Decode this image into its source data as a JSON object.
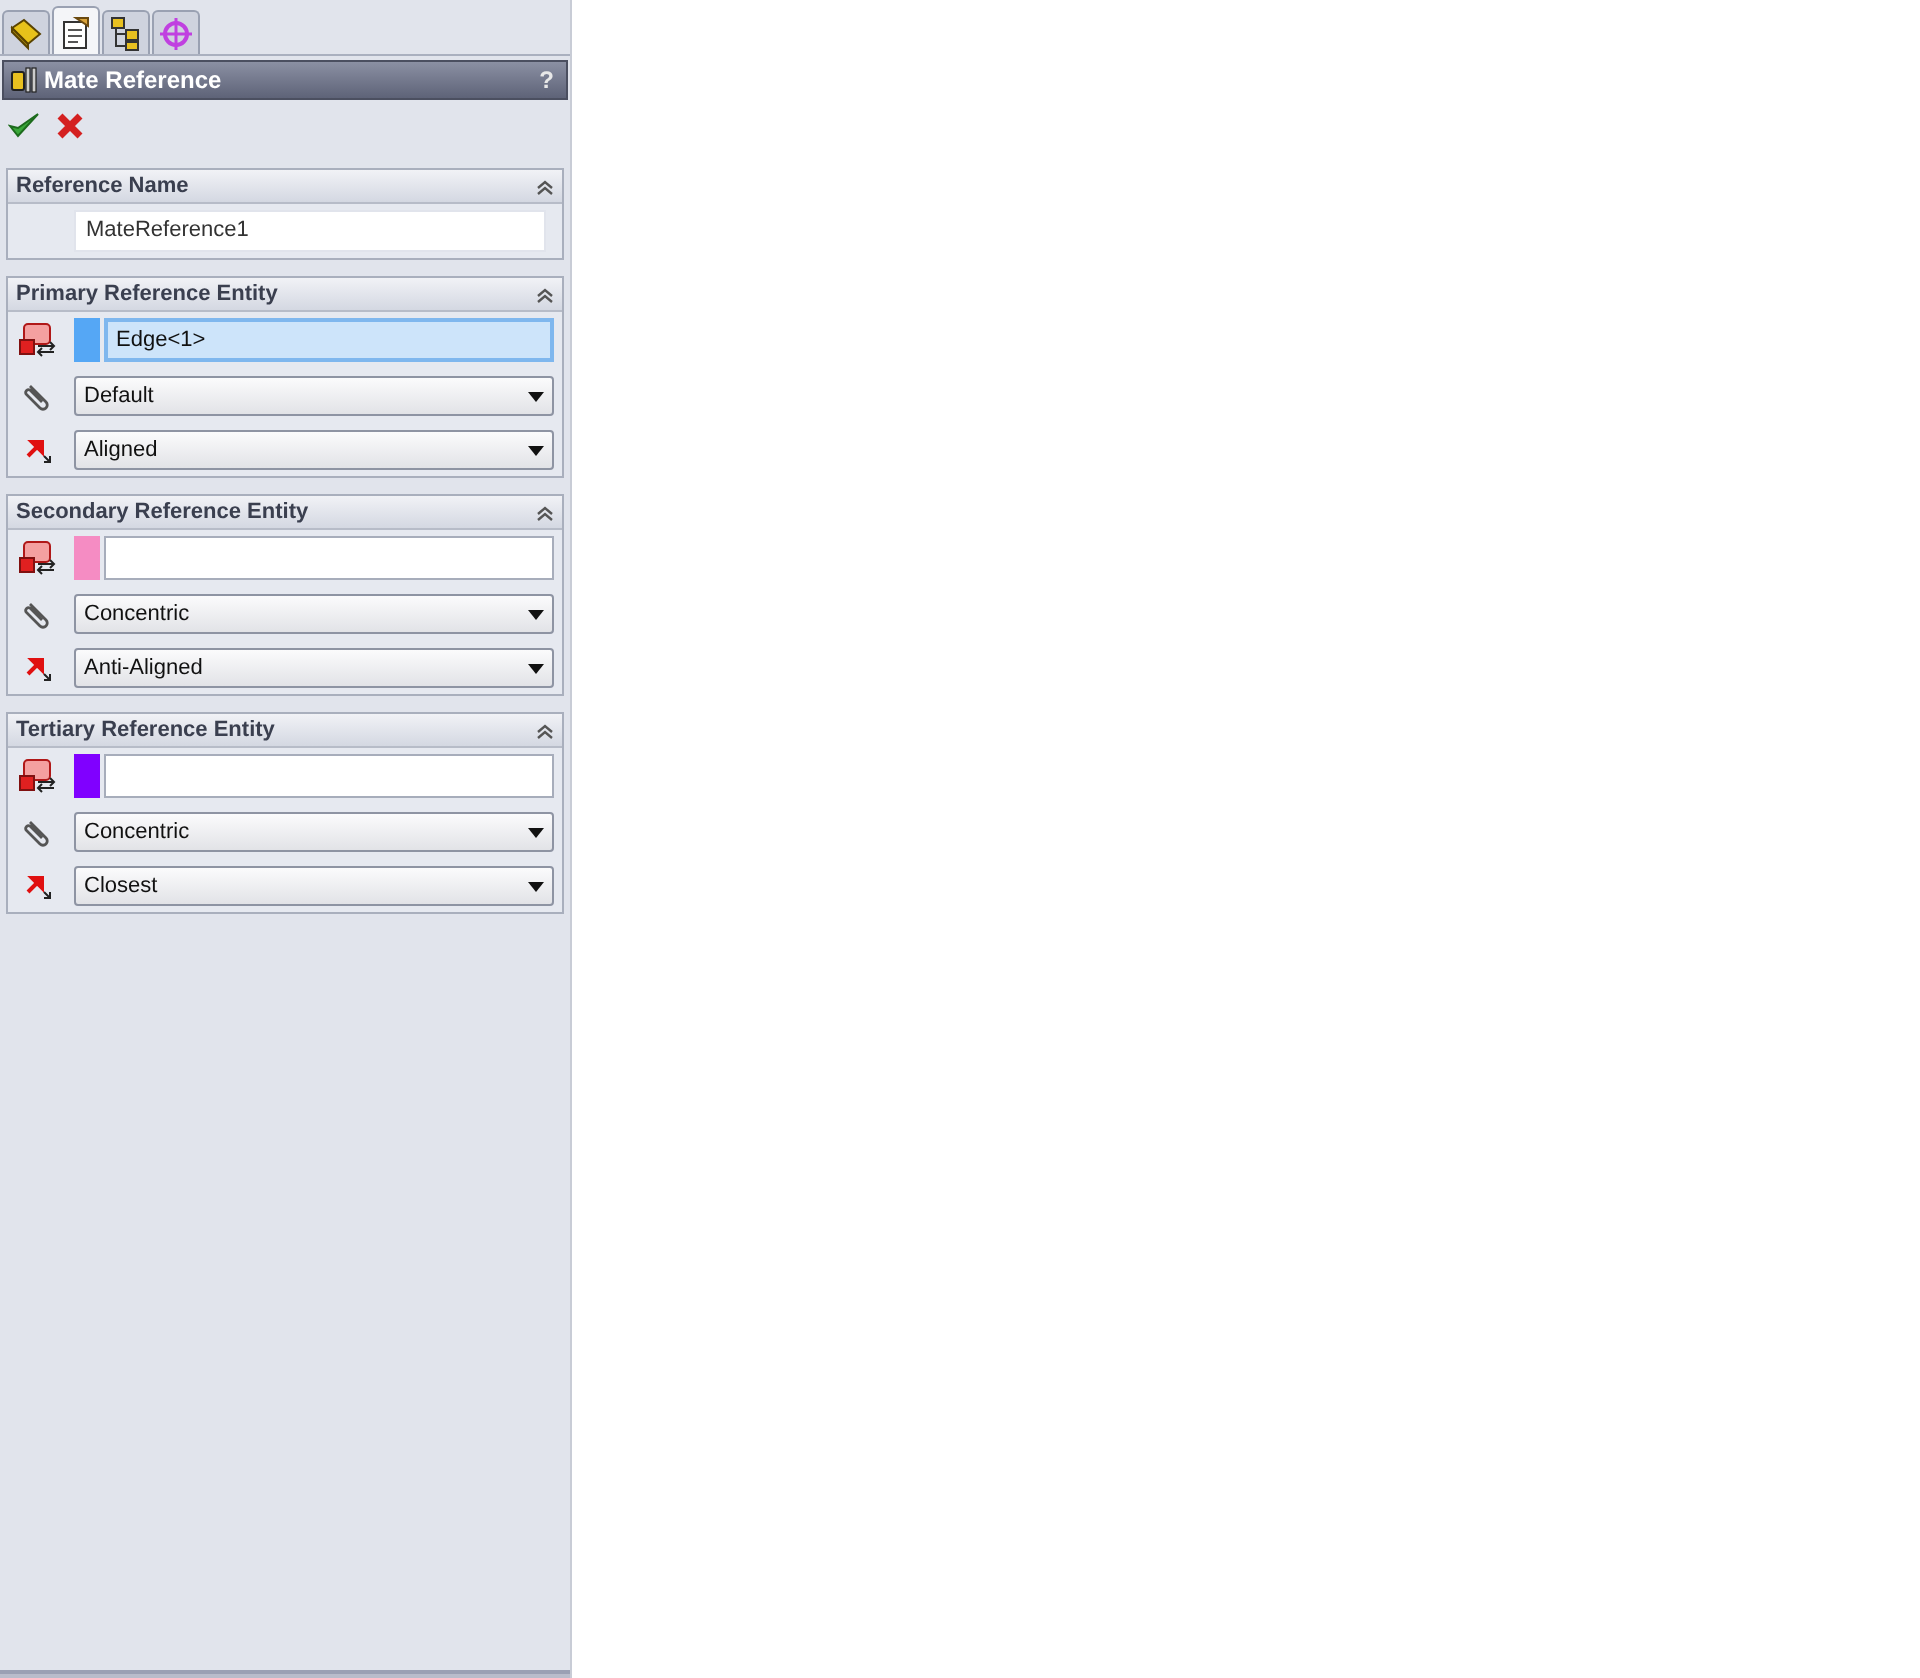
{
  "tabs": [
    {
      "selected": false
    },
    {
      "selected": true
    },
    {
      "selected": false
    },
    {
      "selected": false
    }
  ],
  "panel": {
    "title": "Mate Reference",
    "help": "?"
  },
  "reference_name": {
    "title": "Reference Name",
    "value": "MateReference1"
  },
  "entities": [
    {
      "title": "Primary Reference Entity",
      "color": "#55a7f5",
      "value": "Edge<1>",
      "focused": true,
      "mate_type": "Default",
      "alignment": "Aligned"
    },
    {
      "title": "Secondary Reference Entity",
      "color": "#f58cc3",
      "focused": false,
      "mate_type": "Concentric",
      "alignment": "Anti-Aligned"
    },
    {
      "title": "Tertiary Reference Entity",
      "color": "#8000ff",
      "focused": false,
      "mate_type": "Concentric",
      "alignment": "Closest"
    }
  ]
}
